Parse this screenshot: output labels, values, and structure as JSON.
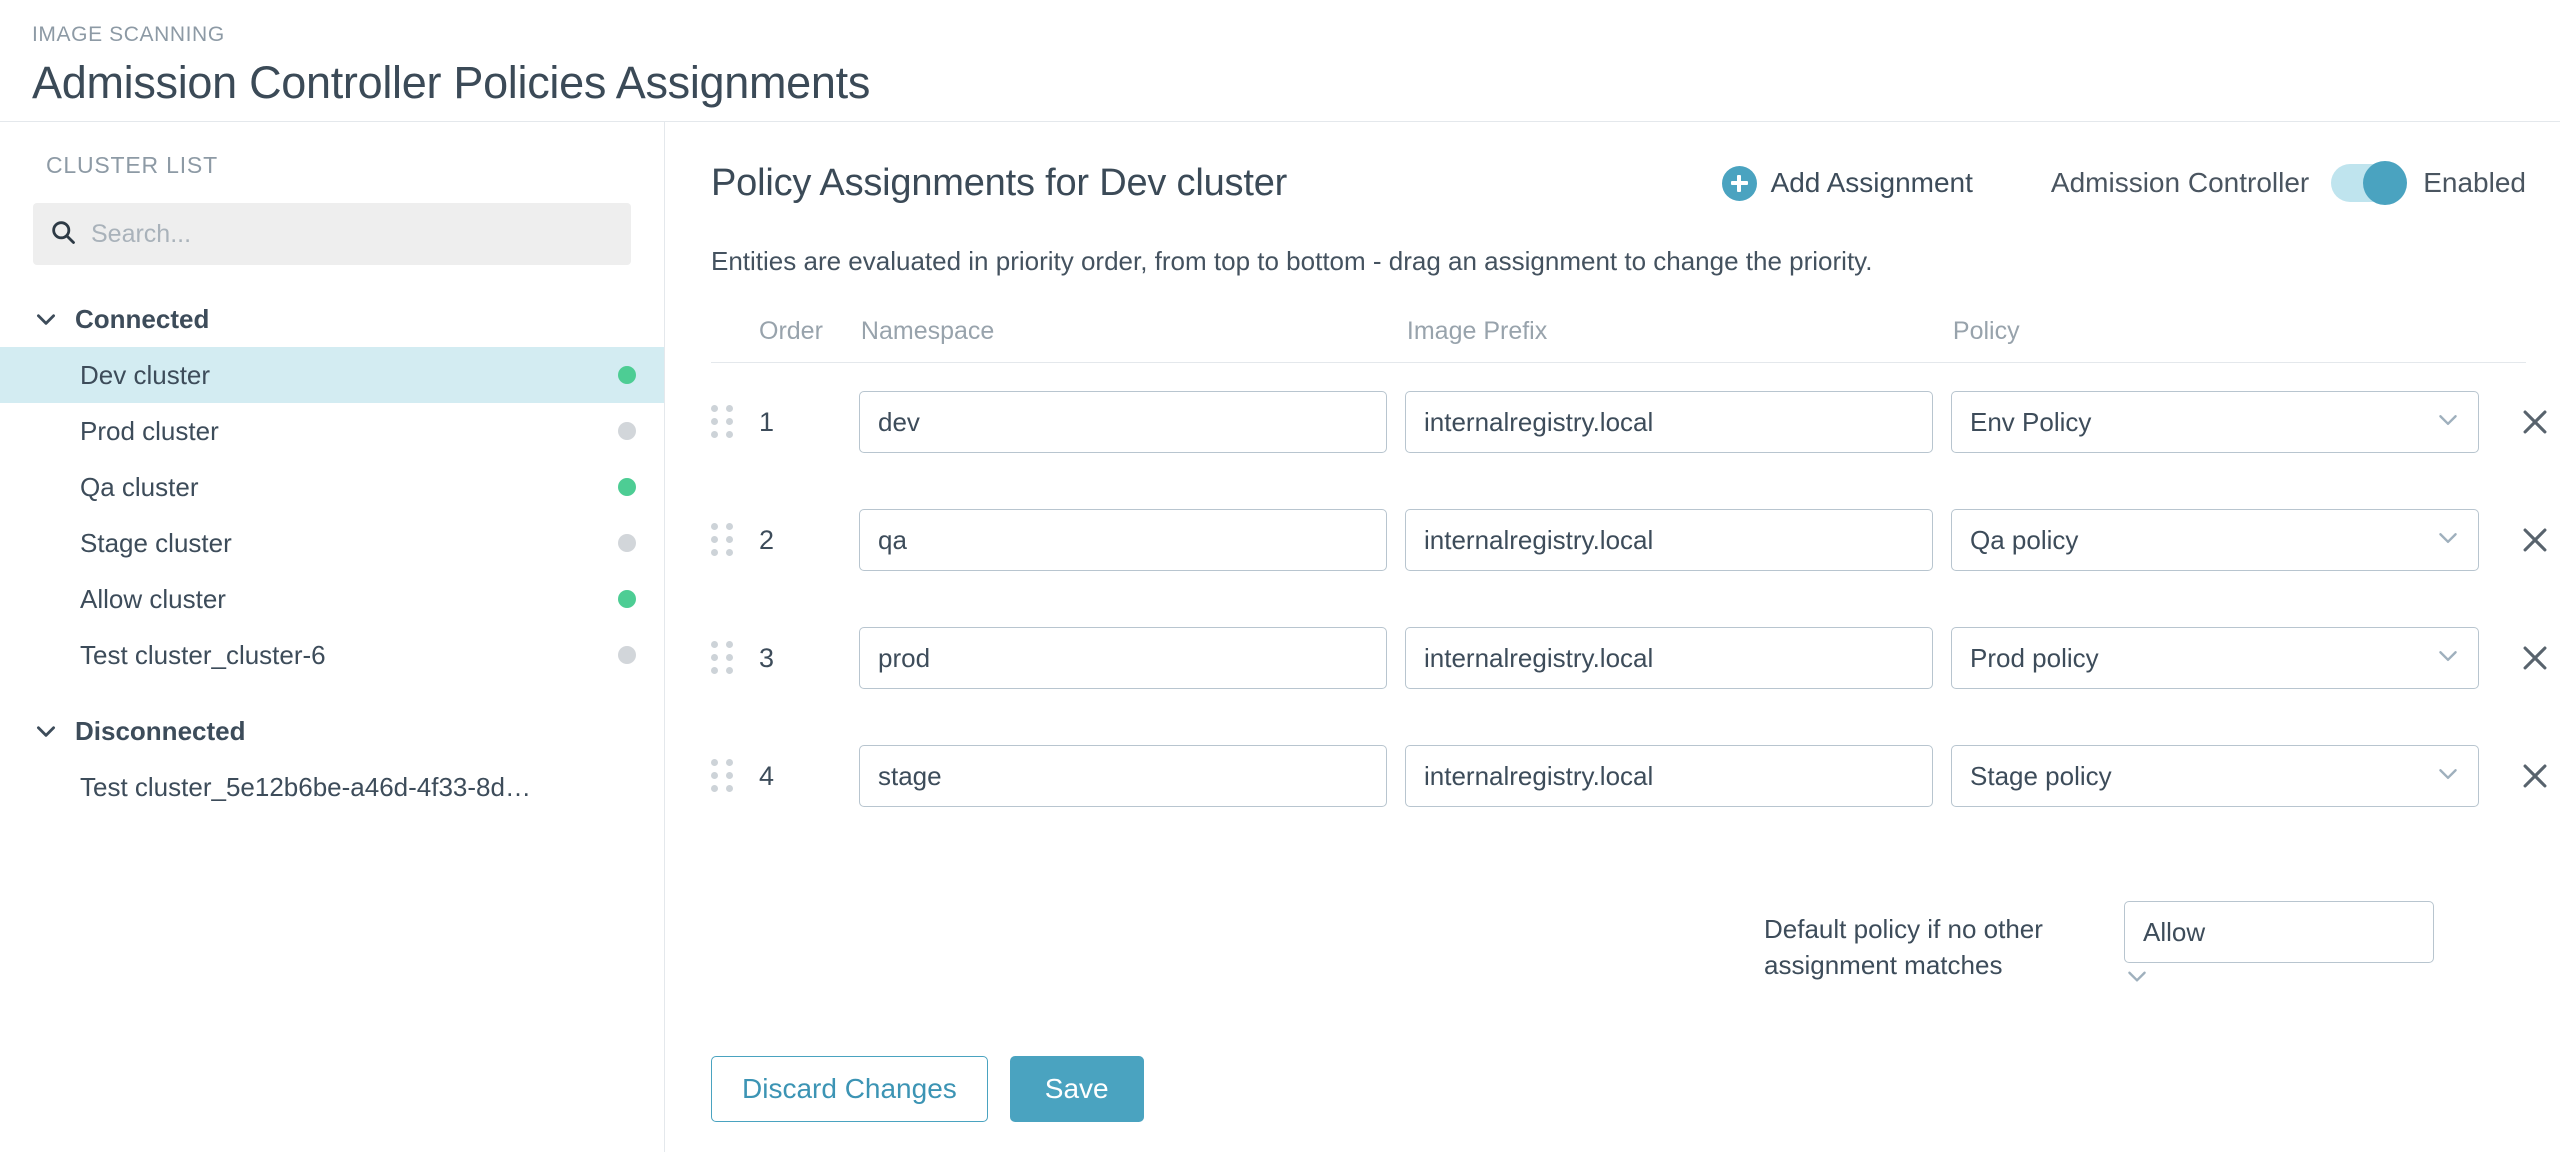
{
  "header": {
    "eyebrow": "IMAGE SCANNING",
    "title": "Admission Controller Policies Assignments"
  },
  "sidebar": {
    "title": "CLUSTER LIST",
    "search": {
      "value": "",
      "placeholder": "Search..."
    },
    "groups": [
      {
        "label": "Connected",
        "expanded": true,
        "items": [
          {
            "name": "Dev cluster",
            "status": "online",
            "selected": true
          },
          {
            "name": "Prod cluster",
            "status": "offline",
            "selected": false
          },
          {
            "name": "Qa cluster",
            "status": "online",
            "selected": false
          },
          {
            "name": "Stage cluster",
            "status": "offline",
            "selected": false
          },
          {
            "name": "Allow cluster",
            "status": "online",
            "selected": false
          },
          {
            "name": "Test cluster_cluster-6",
            "status": "offline",
            "selected": false
          }
        ]
      },
      {
        "label": "Disconnected",
        "expanded": true,
        "items": [
          {
            "name": "Test cluster_5e12b6be-a46d-4f33-8d…",
            "status": "none",
            "selected": false
          }
        ]
      }
    ]
  },
  "main": {
    "panel_title": "Policy Assignments for Dev cluster",
    "add_assignment_label": "Add Assignment",
    "admission_controller_label": "Admission Controller",
    "toggle_state": "Enabled",
    "toggle_on": true,
    "hint": "Entities are evaluated in priority order, from top to bottom - drag an assignment to change the priority.",
    "columns": {
      "order": "Order",
      "namespace": "Namespace",
      "image_prefix": "Image Prefix",
      "policy": "Policy"
    },
    "rows": [
      {
        "order": "1",
        "namespace": "dev",
        "image_prefix": "internalregistry.local",
        "policy": "Env Policy"
      },
      {
        "order": "2",
        "namespace": "qa",
        "image_prefix": "internalregistry.local",
        "policy": "Qa policy"
      },
      {
        "order": "3",
        "namespace": "prod",
        "image_prefix": "internalregistry.local",
        "policy": "Prod policy"
      },
      {
        "order": "4",
        "namespace": "stage",
        "image_prefix": "internalregistry.local",
        "policy": "Stage policy"
      }
    ],
    "default_policy": {
      "label": "Default policy if no other assignment matches",
      "value": "Allow"
    },
    "buttons": {
      "discard": "Discard Changes",
      "save": "Save"
    }
  },
  "colors": {
    "accent": "#4aa3c0",
    "selected_row": "#d3ecf2",
    "status_online": "#4dcd94",
    "status_offline": "#d2d6da"
  },
  "icons": {
    "search": "search-icon",
    "chevron": "chevron-down-icon",
    "plus": "plus-circle-icon",
    "drag": "drag-handle-icon",
    "delete": "close-icon"
  }
}
